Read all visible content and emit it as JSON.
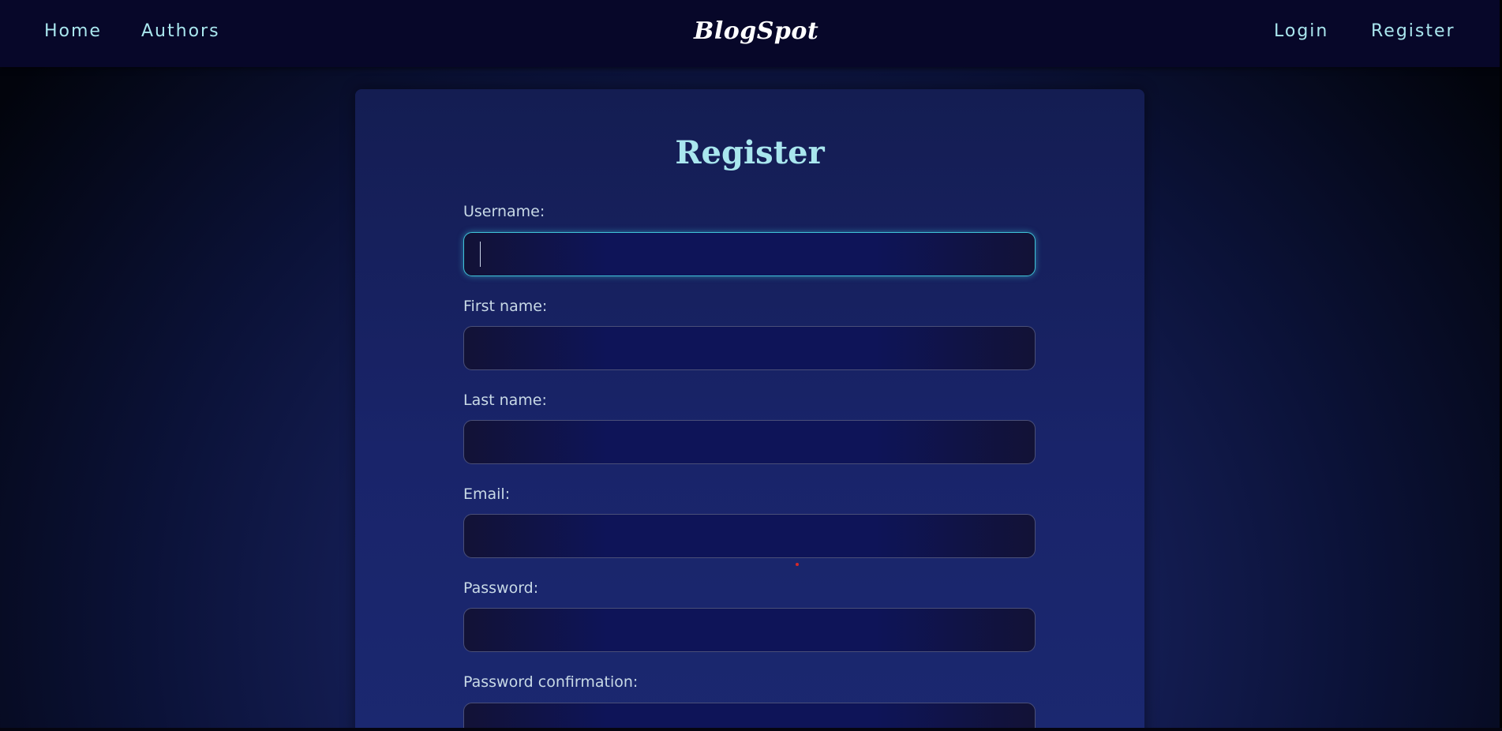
{
  "navbar": {
    "home": "Home",
    "authors": "Authors",
    "brand": "BlogSpot",
    "login": "Login",
    "register": "Register"
  },
  "form": {
    "title": "Register",
    "fields": [
      {
        "label": "Username:",
        "value": ""
      },
      {
        "label": "First name:",
        "value": ""
      },
      {
        "label": "Last name:",
        "value": ""
      },
      {
        "label": "Email:",
        "value": ""
      },
      {
        "label": "Password:",
        "value": ""
      },
      {
        "label": "Password confirmation:",
        "value": ""
      }
    ]
  },
  "colors": {
    "accent": "#a9e6ee",
    "focus_border": "#3fc3d8",
    "navbar_bg": "#070729"
  }
}
